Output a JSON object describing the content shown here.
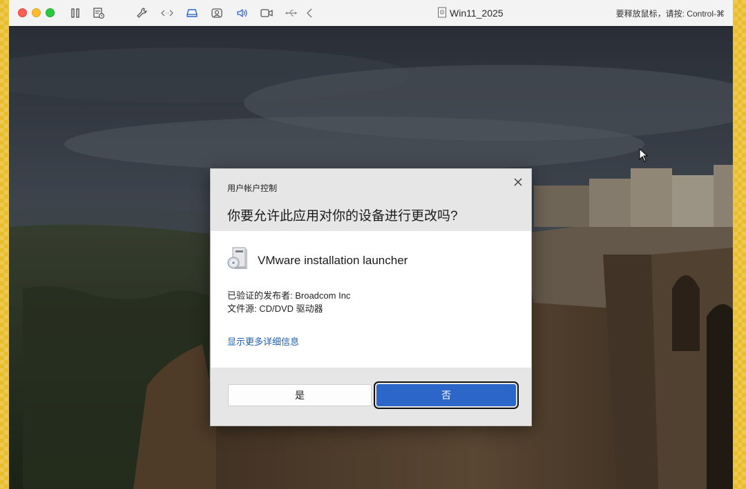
{
  "window": {
    "title": "Win11_2025",
    "release_hint": "要释放鼠标，请按: Control-⌘"
  },
  "toolbar": {
    "icons": [
      "pause-icon",
      "snapshot-icon",
      "wrench-icon",
      "code-arrows-icon",
      "drive-icon",
      "user-icon",
      "speaker-icon",
      "camera-icon",
      "usb-icon",
      "back-chevron-icon"
    ]
  },
  "dialog": {
    "small_title": "用户帐户控制",
    "question": "你要允许此应用对你的设备进行更改吗?",
    "app_name": "VMware installation launcher",
    "publisher_line": "已验证的发布者: Broadcom Inc",
    "source_line": "文件源: CD/DVD 驱动器",
    "details_link": "显示更多详细信息",
    "yes_label": "是",
    "no_label": "否"
  },
  "colors": {
    "accent": "#2b66c8",
    "link": "#1a5fb4",
    "host_bg": "#e9bd2c"
  }
}
